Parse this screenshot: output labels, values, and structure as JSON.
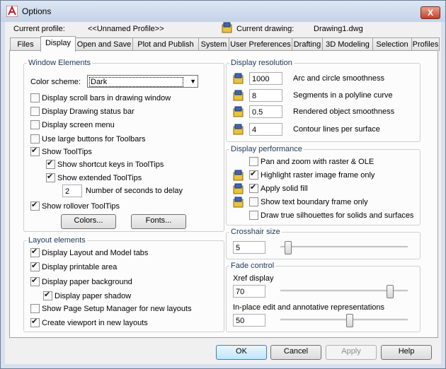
{
  "window": {
    "title": "Options",
    "close": "X"
  },
  "header": {
    "profile_label": "Current profile:",
    "profile_value": "<<Unnamed Profile>>",
    "drawing_label": "Current drawing:",
    "drawing_value": "Drawing1.dwg"
  },
  "tabs": [
    "Files",
    "Display",
    "Open and Save",
    "Plot and Publish",
    "System",
    "User Preferences",
    "Drafting",
    "3D Modeling",
    "Selection",
    "Profiles"
  ],
  "active_tab": "Display",
  "window_elements": {
    "title": "Window Elements",
    "color_scheme_label": "Color scheme:",
    "color_scheme_value": "Dark",
    "scroll_bars": "Display scroll bars in drawing window",
    "status_bar": "Display Drawing status bar",
    "screen_menu": "Display screen menu",
    "large_buttons": "Use large buttons for Toolbars",
    "show_tooltips": "Show ToolTips",
    "shortcut_keys": "Show shortcut keys in ToolTips",
    "extended_tooltips": "Show extended ToolTips",
    "delay_value": "2",
    "delay_label": "Number of seconds to delay",
    "rollover_tooltips": "Show rollover ToolTips",
    "colors_button": "Colors...",
    "fonts_button": "Fonts..."
  },
  "layout_elements": {
    "title": "Layout elements",
    "layout_model_tabs": "Display Layout and Model tabs",
    "printable_area": "Display printable area",
    "paper_background": "Display paper background",
    "paper_shadow": "Display paper shadow",
    "page_setup": "Show Page Setup Manager for new layouts",
    "create_viewport": "Create viewport in new layouts"
  },
  "display_resolution": {
    "title": "Display resolution",
    "items": [
      {
        "value": "1000",
        "label": "Arc and circle smoothness"
      },
      {
        "value": "8",
        "label": "Segments in a polyline curve"
      },
      {
        "value": "0.5",
        "label": "Rendered object smoothness"
      },
      {
        "value": "4",
        "label": "Contour lines per surface"
      }
    ]
  },
  "display_performance": {
    "title": "Display performance",
    "pan_zoom": "Pan and zoom with raster & OLE",
    "highlight_raster": "Highlight raster image frame only",
    "apply_solid_fill": "Apply solid fill",
    "text_boundary": "Show text boundary frame only",
    "silhouettes": "Draw true silhouettes for solids and surfaces"
  },
  "crosshair": {
    "title": "Crosshair size",
    "value": "5"
  },
  "fade": {
    "title": "Fade control",
    "xref_label": "Xref display",
    "xref_value": "70",
    "inplace_label": "In-place edit and annotative representations",
    "inplace_value": "50"
  },
  "footer": {
    "ok": "OK",
    "cancel": "Cancel",
    "apply": "Apply",
    "help": "Help"
  },
  "colors": {
    "accent": "#1e395b",
    "titlebar": "#c5d3e8",
    "close": "#c2422a"
  }
}
